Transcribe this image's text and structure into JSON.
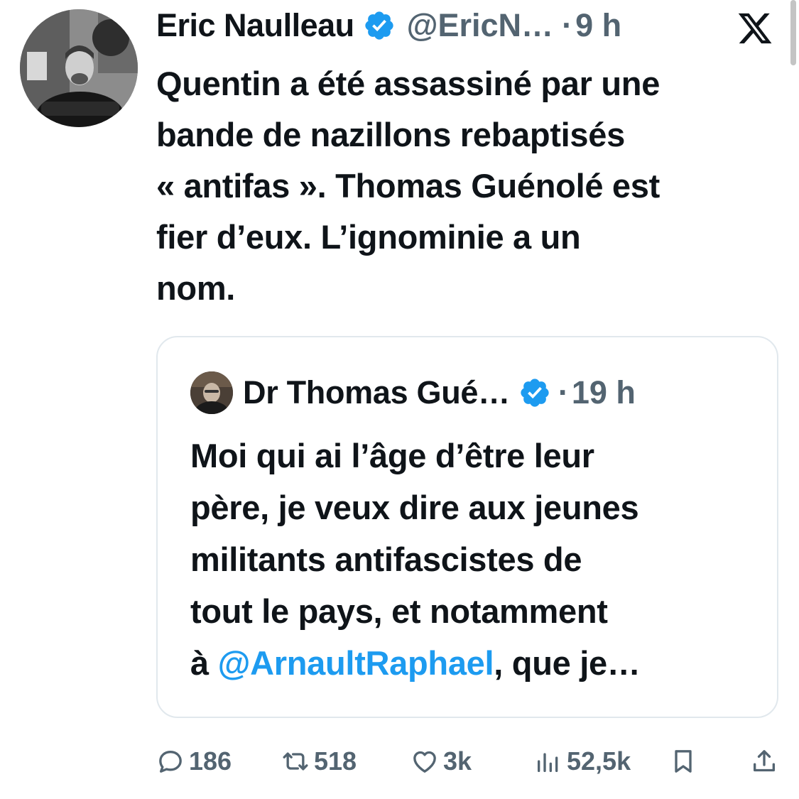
{
  "tweet": {
    "author_name": "Eric Naulleau",
    "handle": "@EricN…",
    "separator": "·",
    "time": "9 h",
    "text_lines": [
      "Quentin a été assassiné par une",
      "bande de nazillons rebaptisés",
      "« antifas ». Thomas Guénolé est",
      "fier d’eux. L’ignominie a un",
      "nom."
    ],
    "verified_icon": "verified-badge-icon",
    "platform_icon": "x-logo-icon"
  },
  "quote": {
    "author_name": "Dr Thomas Gué…",
    "separator": "·",
    "time": "19 h",
    "text_lines": [
      "Moi qui ai l’âge d’être leur",
      "père, je veux dire aux jeunes",
      "militants antifascistes de",
      "tout le pays, et notamment"
    ],
    "last_line": {
      "prefix": "à ",
      "mention": "@ArnaultRaphael",
      "suffix": ", que je…"
    }
  },
  "actions": {
    "replies": "186",
    "retweets": "518",
    "likes": "3k",
    "views": "52,5k"
  },
  "colors": {
    "text": "#0f1419",
    "secondary": "#536471",
    "accent": "#1d9bf0",
    "border": "#e1e8ed"
  }
}
